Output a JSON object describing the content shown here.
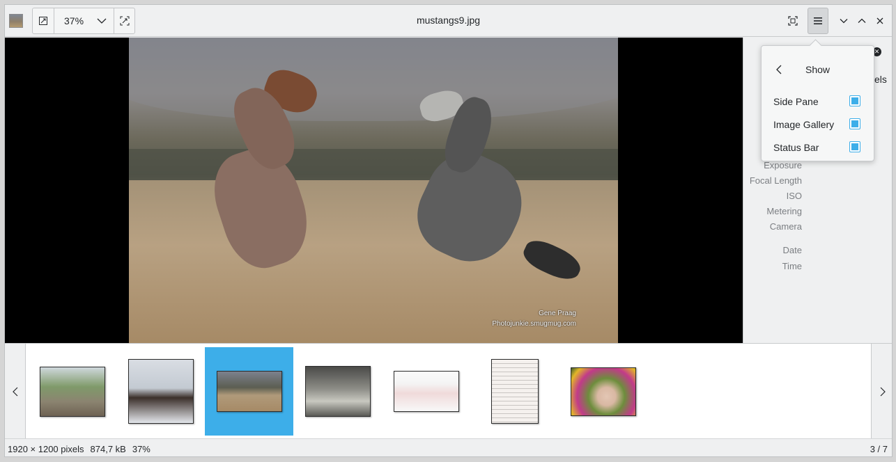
{
  "window": {
    "title": "mustangs9.jpg"
  },
  "toolbar": {
    "zoom_value": "37%",
    "icons": {
      "app": "image-thumbnail-icon",
      "zoom_to_fit": "zoom-fit-icon",
      "zoom_dropdown": "chevron-down-icon",
      "zoom_fill": "zoom-fill-icon",
      "fullscreen": "fullscreen-icon",
      "menu": "hamburger-menu-icon",
      "minimize": "chevron-down-icon",
      "maximize": "chevron-up-icon",
      "close": "close-icon"
    }
  },
  "photo": {
    "caption_line1": "Gene Praag",
    "caption_line2": "Photojunkie.smugmug.com"
  },
  "side_pane": {
    "partial_text": "els",
    "labels": [
      "Exposure",
      "Focal Length",
      "ISO",
      "Metering",
      "Camera",
      "Date",
      "Time"
    ]
  },
  "menu_popover": {
    "title": "Show",
    "items": [
      {
        "label": "Side Pane",
        "checked": true
      },
      {
        "label": "Image Gallery",
        "checked": true
      },
      {
        "label": "Status Bar",
        "checked": true
      }
    ]
  },
  "gallery": {
    "selected_index": 2,
    "thumbnails": [
      "deer-and-police-car",
      "moose-rider-in-snow",
      "mustangs-fighting",
      "vintage-group-photo",
      "webpage-screenshot",
      "document-page",
      "snail-with-flowers"
    ]
  },
  "status_bar": {
    "dimensions": "1920 × 1200 pixels",
    "file_size": "874,7 kB",
    "zoom": "37%",
    "position": "3 / 7"
  },
  "colors": {
    "accent": "#3daee9",
    "background": "#eff0f1",
    "text": "#232629"
  }
}
